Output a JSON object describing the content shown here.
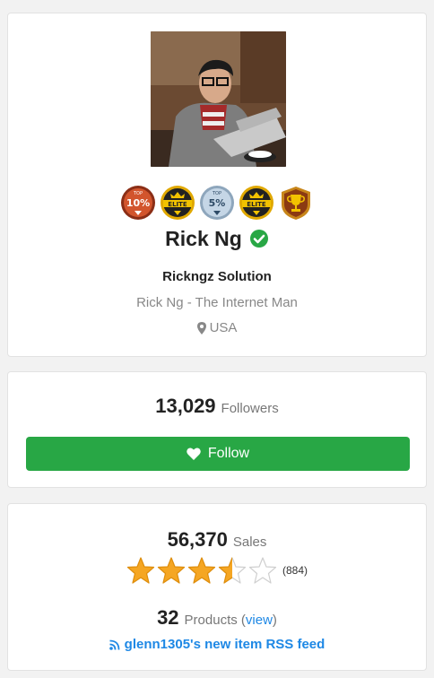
{
  "profile": {
    "badges": [
      {
        "icon": "top-10-percent-badge-icon",
        "text": "10%",
        "top": "TOP"
      },
      {
        "icon": "elite-badge-icon",
        "text": "ELITE"
      },
      {
        "icon": "top-5-percent-badge-icon",
        "text": "5%",
        "top": "TOP"
      },
      {
        "icon": "elite-badge-icon",
        "text": "ELITE"
      },
      {
        "icon": "trophy-badge-icon"
      }
    ],
    "name": "Rick Ng",
    "company": "Rickngz Solution",
    "tagline": "Rick Ng - The Internet Man",
    "location": "USA"
  },
  "followers": {
    "count": "13,029",
    "label": "Followers",
    "button_label": "Follow"
  },
  "stats": {
    "sales_count": "56,370",
    "sales_label": "Sales",
    "rating": 3.5,
    "rating_max": 5,
    "rating_count": "(884)",
    "products_count": "32",
    "products_label": "Products (",
    "view_label": "view",
    "products_close": ")",
    "rss_label": "glenn1305's new item RSS feed"
  },
  "colors": {
    "accent_green": "#28a745",
    "link_blue": "#1e88e5",
    "star_orange": "#f5a623"
  }
}
